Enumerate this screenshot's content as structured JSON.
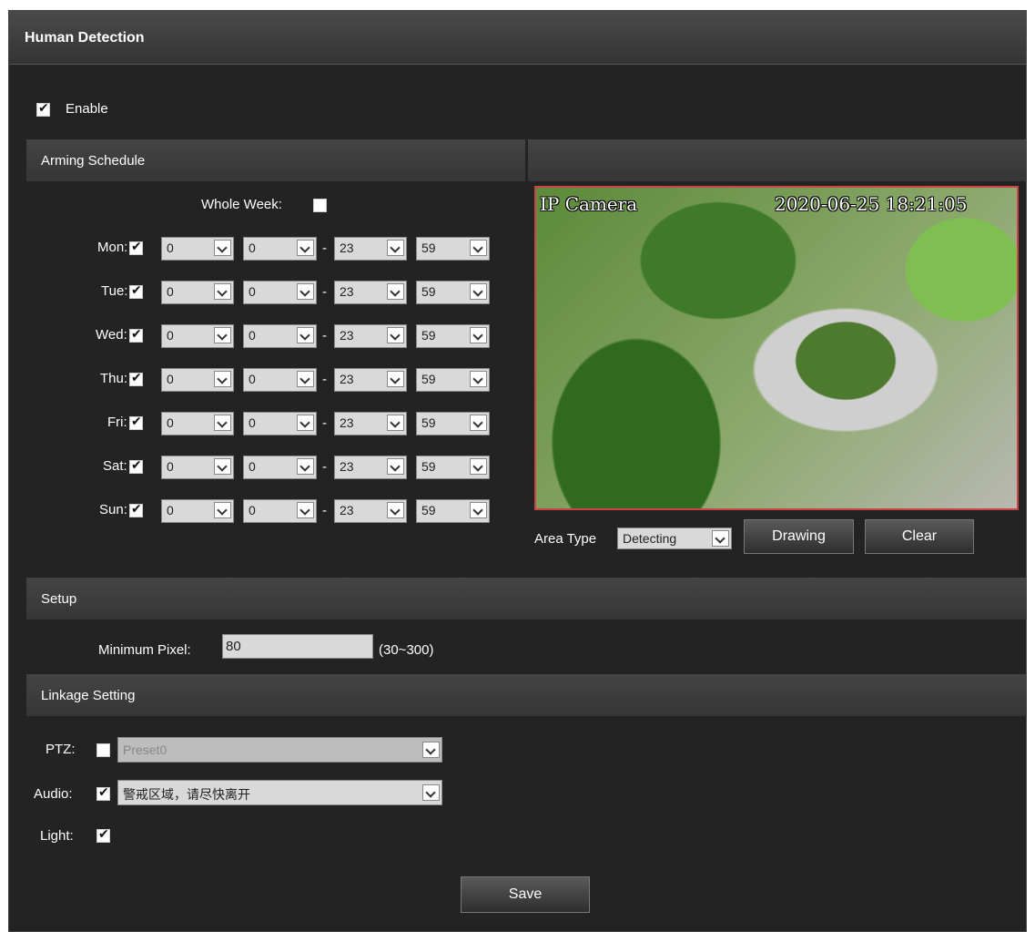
{
  "title": "Human Detection",
  "enable": {
    "label": "Enable",
    "checked": true
  },
  "sections": {
    "arming_schedule": "Arming Schedule",
    "setup": "Setup",
    "linkage": "Linkage Setting"
  },
  "whole_week": {
    "label": "Whole Week:",
    "checked": false
  },
  "schedule": [
    {
      "day": "Mon:",
      "checked": true,
      "start_h": "0",
      "start_m": "0",
      "end_h": "23",
      "end_m": "59"
    },
    {
      "day": "Tue:",
      "checked": true,
      "start_h": "0",
      "start_m": "0",
      "end_h": "23",
      "end_m": "59"
    },
    {
      "day": "Wed:",
      "checked": true,
      "start_h": "0",
      "start_m": "0",
      "end_h": "23",
      "end_m": "59"
    },
    {
      "day": "Thu:",
      "checked": true,
      "start_h": "0",
      "start_m": "0",
      "end_h": "23",
      "end_m": "59"
    },
    {
      "day": "Fri:",
      "checked": true,
      "start_h": "0",
      "start_m": "0",
      "end_h": "23",
      "end_m": "59"
    },
    {
      "day": "Sat:",
      "checked": true,
      "start_h": "0",
      "start_m": "0",
      "end_h": "23",
      "end_m": "59"
    },
    {
      "day": "Sun:",
      "checked": true,
      "start_h": "0",
      "start_m": "0",
      "end_h": "23",
      "end_m": "59"
    }
  ],
  "dash": "-",
  "camera": {
    "name": "IP Camera",
    "timestamp": "2020-06-25 18:21:05"
  },
  "area": {
    "label": "Area Type",
    "value": "Detecting",
    "drawing": "Drawing",
    "clear": "Clear"
  },
  "setup": {
    "min_pixel_label": "Minimum Pixel:",
    "min_pixel_value": "80",
    "range": "(30~300)"
  },
  "linkage": {
    "ptz": {
      "label": "PTZ:",
      "checked": false,
      "value": "Preset0"
    },
    "audio": {
      "label": "Audio:",
      "checked": true,
      "value": "警戒区域，请尽快离开"
    },
    "light": {
      "label": "Light:",
      "checked": true
    }
  },
  "save": "Save"
}
